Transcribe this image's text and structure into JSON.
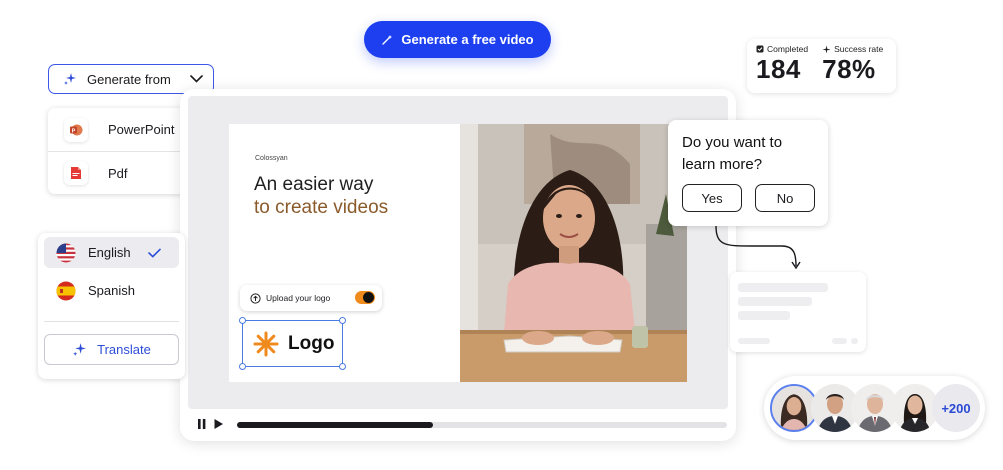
{
  "cta": {
    "label": "Generate a free video"
  },
  "stats": [
    {
      "label": "Completed",
      "value": "184"
    },
    {
      "label": "Success rate",
      "value": "78%"
    }
  ],
  "generate_from": {
    "label": "Generate from",
    "items": [
      {
        "label": "PowerPoint",
        "icon": "powerpoint-icon",
        "color": "#d35230"
      },
      {
        "label": "Pdf",
        "icon": "pdf-icon",
        "color": "#e53935"
      }
    ]
  },
  "slide": {
    "brand": "Colossyan",
    "headline_line1": "An easier way",
    "headline_line2": "to create videos",
    "upload_label": "Upload your logo",
    "logo_text": "Logo"
  },
  "player": {
    "progress": 0.4
  },
  "languages": {
    "items": [
      {
        "label": "English",
        "selected": true,
        "icon": "us-flag-icon"
      },
      {
        "label": "Spanish",
        "selected": false,
        "icon": "spain-flag-icon"
      }
    ],
    "translate_label": "Translate"
  },
  "question": {
    "text_line1": "Do you want to",
    "text_line2": "learn more?",
    "yes": "Yes",
    "no": "No"
  },
  "avatars": {
    "more_label": "+200"
  },
  "colors": {
    "accent": "#1d3ff0",
    "headline_accent": "#8a5a2b",
    "toggle": "#f08a1c"
  }
}
